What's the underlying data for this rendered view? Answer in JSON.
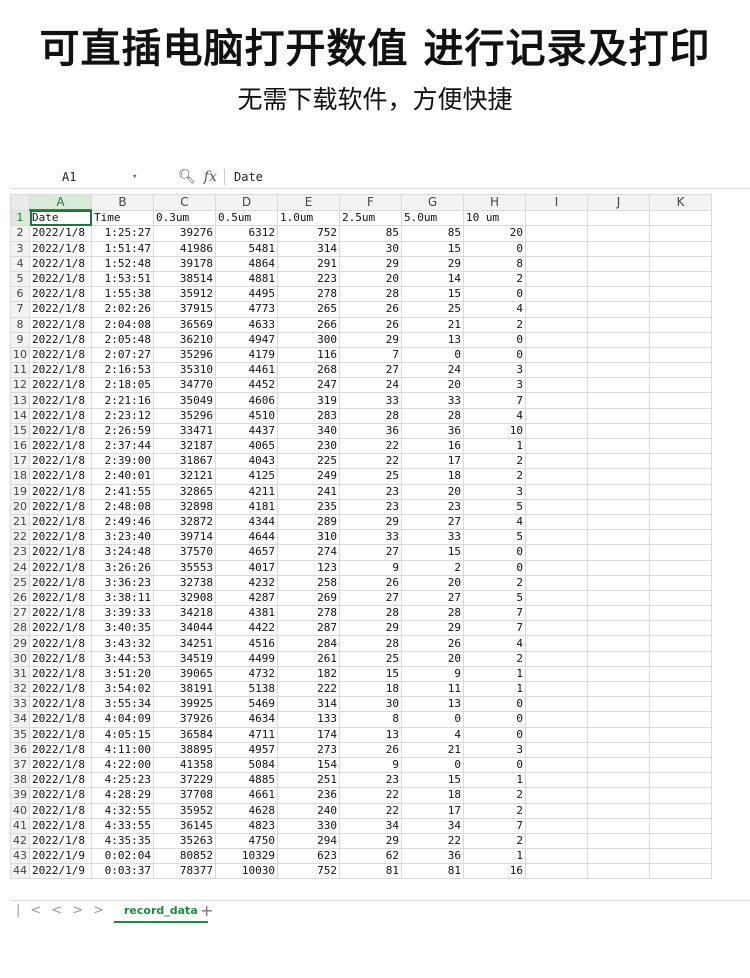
{
  "headline": "可直插电脑打开数值 进行记录及打印",
  "subline": "无需下载软件，方便快捷",
  "formula_bar": {
    "cell_ref": "A1",
    "content": "Date",
    "zoom_icon": "magnifier-icon",
    "fx_label": "fx"
  },
  "columns": [
    "A",
    "B",
    "C",
    "D",
    "E",
    "F",
    "G",
    "H",
    "I",
    "J",
    "K"
  ],
  "header_row": [
    "Date",
    "Time",
    "0.3um",
    "0.5um",
    "1.0um",
    "2.5um",
    "5.0um",
    "10 um"
  ],
  "rows": [
    [
      "2022/1/8",
      "1:25:27",
      "39276",
      "6312",
      "752",
      "85",
      "85",
      "20"
    ],
    [
      "2022/1/8",
      "1:51:47",
      "41986",
      "5481",
      "314",
      "30",
      "15",
      "0"
    ],
    [
      "2022/1/8",
      "1:52:48",
      "39178",
      "4864",
      "291",
      "29",
      "29",
      "8"
    ],
    [
      "2022/1/8",
      "1:53:51",
      "38514",
      "4881",
      "223",
      "20",
      "14",
      "2"
    ],
    [
      "2022/1/8",
      "1:55:38",
      "35912",
      "4495",
      "278",
      "28",
      "15",
      "0"
    ],
    [
      "2022/1/8",
      "2:02:26",
      "37915",
      "4773",
      "265",
      "26",
      "25",
      "4"
    ],
    [
      "2022/1/8",
      "2:04:08",
      "36569",
      "4633",
      "266",
      "26",
      "21",
      "2"
    ],
    [
      "2022/1/8",
      "2:05:48",
      "36210",
      "4947",
      "300",
      "29",
      "13",
      "0"
    ],
    [
      "2022/1/8",
      "2:07:27",
      "35296",
      "4179",
      "116",
      "7",
      "0",
      "0"
    ],
    [
      "2022/1/8",
      "2:16:53",
      "35310",
      "4461",
      "268",
      "27",
      "24",
      "3"
    ],
    [
      "2022/1/8",
      "2:18:05",
      "34770",
      "4452",
      "247",
      "24",
      "20",
      "3"
    ],
    [
      "2022/1/8",
      "2:21:16",
      "35049",
      "4606",
      "319",
      "33",
      "33",
      "7"
    ],
    [
      "2022/1/8",
      "2:23:12",
      "35296",
      "4510",
      "283",
      "28",
      "28",
      "4"
    ],
    [
      "2022/1/8",
      "2:26:59",
      "33471",
      "4437",
      "340",
      "36",
      "36",
      "10"
    ],
    [
      "2022/1/8",
      "2:37:44",
      "32187",
      "4065",
      "230",
      "22",
      "16",
      "1"
    ],
    [
      "2022/1/8",
      "2:39:00",
      "31867",
      "4043",
      "225",
      "22",
      "17",
      "2"
    ],
    [
      "2022/1/8",
      "2:40:01",
      "32121",
      "4125",
      "249",
      "25",
      "18",
      "2"
    ],
    [
      "2022/1/8",
      "2:41:55",
      "32865",
      "4211",
      "241",
      "23",
      "20",
      "3"
    ],
    [
      "2022/1/8",
      "2:48:08",
      "32898",
      "4181",
      "235",
      "23",
      "23",
      "5"
    ],
    [
      "2022/1/8",
      "2:49:46",
      "32872",
      "4344",
      "289",
      "29",
      "27",
      "4"
    ],
    [
      "2022/1/8",
      "3:23:40",
      "39714",
      "4644",
      "310",
      "33",
      "33",
      "5"
    ],
    [
      "2022/1/8",
      "3:24:48",
      "37570",
      "4657",
      "274",
      "27",
      "15",
      "0"
    ],
    [
      "2022/1/8",
      "3:26:26",
      "35553",
      "4017",
      "123",
      "9",
      "2",
      "0"
    ],
    [
      "2022/1/8",
      "3:36:23",
      "32738",
      "4232",
      "258",
      "26",
      "20",
      "2"
    ],
    [
      "2022/1/8",
      "3:38:11",
      "32908",
      "4287",
      "269",
      "27",
      "27",
      "5"
    ],
    [
      "2022/1/8",
      "3:39:33",
      "34218",
      "4381",
      "278",
      "28",
      "28",
      "7"
    ],
    [
      "2022/1/8",
      "3:40:35",
      "34044",
      "4422",
      "287",
      "29",
      "29",
      "7"
    ],
    [
      "2022/1/8",
      "3:43:32",
      "34251",
      "4516",
      "284",
      "28",
      "26",
      "4"
    ],
    [
      "2022/1/8",
      "3:44:53",
      "34519",
      "4499",
      "261",
      "25",
      "20",
      "2"
    ],
    [
      "2022/1/8",
      "3:51:20",
      "39065",
      "4732",
      "182",
      "15",
      "9",
      "1"
    ],
    [
      "2022/1/8",
      "3:54:02",
      "38191",
      "5138",
      "222",
      "18",
      "11",
      "1"
    ],
    [
      "2022/1/8",
      "3:55:34",
      "39925",
      "5469",
      "314",
      "30",
      "13",
      "0"
    ],
    [
      "2022/1/8",
      "4:04:09",
      "37926",
      "4634",
      "133",
      "8",
      "0",
      "0"
    ],
    [
      "2022/1/8",
      "4:05:15",
      "36584",
      "4711",
      "174",
      "13",
      "4",
      "0"
    ],
    [
      "2022/1/8",
      "4:11:00",
      "38895",
      "4957",
      "273",
      "26",
      "21",
      "3"
    ],
    [
      "2022/1/8",
      "4:22:00",
      "41358",
      "5084",
      "154",
      "9",
      "0",
      "0"
    ],
    [
      "2022/1/8",
      "4:25:23",
      "37229",
      "4885",
      "251",
      "23",
      "15",
      "1"
    ],
    [
      "2022/1/8",
      "4:28:29",
      "37708",
      "4661",
      "236",
      "22",
      "18",
      "2"
    ],
    [
      "2022/1/8",
      "4:32:55",
      "35952",
      "4628",
      "240",
      "22",
      "17",
      "2"
    ],
    [
      "2022/1/8",
      "4:33:55",
      "36145",
      "4823",
      "330",
      "34",
      "34",
      "7"
    ],
    [
      "2022/1/8",
      "4:35:35",
      "35263",
      "4750",
      "294",
      "29",
      "22",
      "2"
    ],
    [
      "2022/1/9",
      "0:02:04",
      "80852",
      "10329",
      "623",
      "62",
      "36",
      "1"
    ],
    [
      "2022/1/9",
      "0:03:37",
      "78377",
      "10030",
      "752",
      "81",
      "81",
      "16"
    ]
  ],
  "sheet_tab": {
    "name": "record_data",
    "add_label": "+",
    "nav": [
      "|<",
      "<",
      ">",
      ">|"
    ]
  }
}
